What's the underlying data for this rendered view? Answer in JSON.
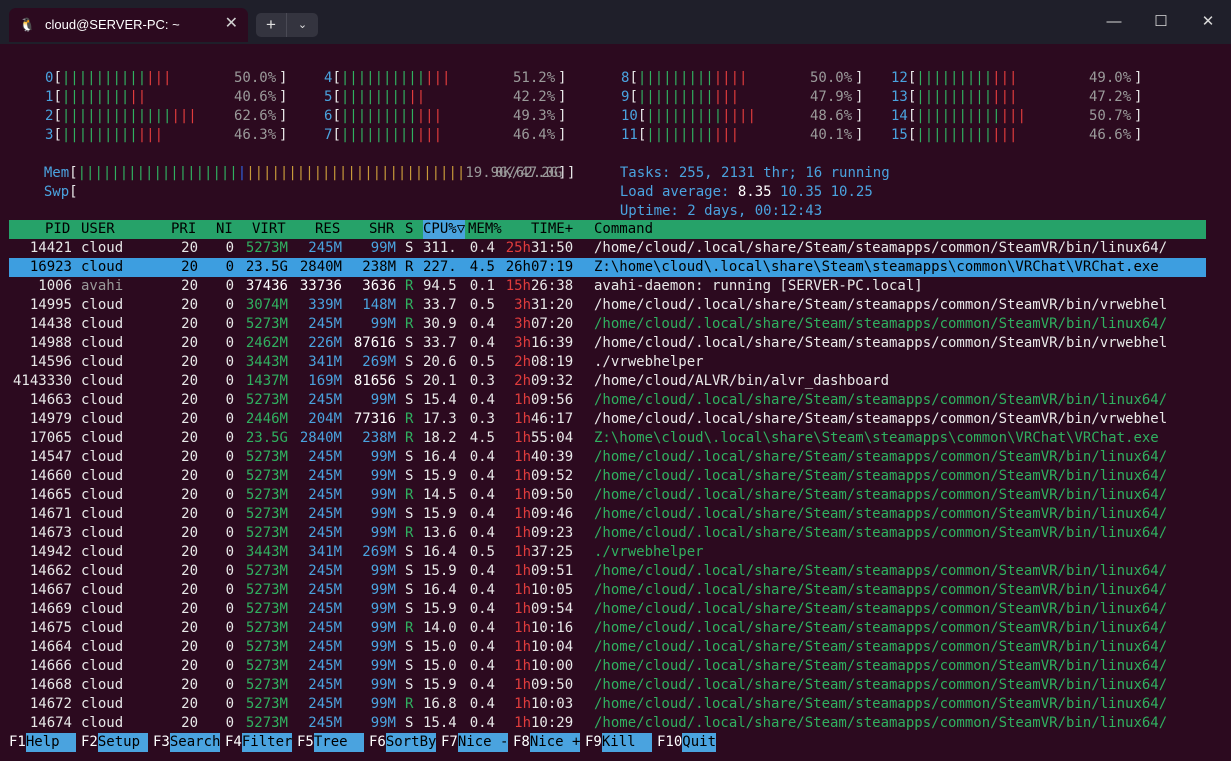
{
  "window": {
    "tab_title": "cloud@SERVER-PC: ~",
    "tab_icon": "linux-penguin-icon",
    "close_tab": "✕",
    "new_tab": "+",
    "dropdown": "⌄",
    "minimize": "—",
    "maximize": "☐",
    "close": "✕"
  },
  "cpus": [
    {
      "id": "0",
      "pct": "50.0%",
      "g": 10,
      "r": 3
    },
    {
      "id": "1",
      "pct": "40.6%",
      "g": 8,
      "r": 2
    },
    {
      "id": "2",
      "pct": "62.6%",
      "g": 13,
      "r": 3
    },
    {
      "id": "3",
      "pct": "46.3%",
      "g": 9,
      "r": 3
    },
    {
      "id": "4",
      "pct": "51.2%",
      "g": 10,
      "r": 3
    },
    {
      "id": "5",
      "pct": "42.2%",
      "g": 8,
      "r": 2
    },
    {
      "id": "6",
      "pct": "49.3%",
      "g": 9,
      "r": 3
    },
    {
      "id": "7",
      "pct": "46.4%",
      "g": 9,
      "r": 3
    },
    {
      "id": "8",
      "pct": "50.0%",
      "g": 9,
      "r": 4
    },
    {
      "id": "9",
      "pct": "47.9%",
      "g": 9,
      "r": 3
    },
    {
      "id": "10",
      "pct": "48.6%",
      "g": 9,
      "r": 4
    },
    {
      "id": "11",
      "pct": "40.1%",
      "g": 8,
      "r": 3
    },
    {
      "id": "12",
      "pct": "49.0%",
      "g": 9,
      "r": 3
    },
    {
      "id": "13",
      "pct": "47.2%",
      "g": 9,
      "r": 3
    },
    {
      "id": "14",
      "pct": "50.7%",
      "g": 10,
      "r": 3
    },
    {
      "id": "15",
      "pct": "46.6%",
      "g": 9,
      "r": 3
    }
  ],
  "mem": {
    "label": "Mem",
    "value": "19.9G/62.2G"
  },
  "swp": {
    "label": "Swp",
    "value": "0K/47.0G"
  },
  "tasks": {
    "label": "Tasks: ",
    "tasks": "255",
    "sep1": ", ",
    "thr": "2131",
    "thr_label": " thr; ",
    "running": "16",
    "running_label": " running"
  },
  "load": {
    "label": "Load average: ",
    "v1": "8.35",
    "v2": "10.35",
    "v3": "10.25"
  },
  "uptime": {
    "label": "Uptime: ",
    "value": "2 days, 00:12:43"
  },
  "columns": {
    "pid": "PID",
    "user": "USER",
    "pri": "PRI",
    "ni": "NI",
    "virt": "VIRT",
    "res": "RES",
    "shr": "SHR",
    "s": "S",
    "cpu": "CPU%▽",
    "mem": "MEM%",
    "time": "TIME+",
    "cmd": "Command"
  },
  "processes": [
    {
      "pid": "14421",
      "user": "cloud",
      "pri": "20",
      "ni": "0",
      "virt": "5273M",
      "res": "245M",
      "shr": "99M",
      "s": "S",
      "cpu": "311.",
      "mem": "0.4",
      "th": "25h",
      "tm": "31:50",
      "cmd": "/home/cloud/.local/share/Steam/steamapps/common/SteamVR/bin/linux64/",
      "thread": false
    },
    {
      "pid": "16923",
      "user": "cloud",
      "pri": "20",
      "ni": "0",
      "virt": "23.5G",
      "res": "2840M",
      "shr": "238M",
      "s": "R",
      "cpu": "227.",
      "mem": "4.5",
      "th": "26h",
      "tm": "07:19",
      "cmd": "Z:\\home\\cloud\\.local\\share\\Steam\\steamapps\\common\\VRChat\\VRChat.exe",
      "thread": false,
      "selected": true
    },
    {
      "pid": "1006",
      "user": "avahi",
      "pri": "20",
      "ni": "0",
      "virt": "37436",
      "res": "33736",
      "shr": "3636",
      "s": "R",
      "cpu": "94.5",
      "mem": "0.1",
      "th": "15h",
      "tm": "26:38",
      "cmd": "avahi-daemon: running [SERVER-PC.local]",
      "thread": false
    },
    {
      "pid": "14995",
      "user": "cloud",
      "pri": "20",
      "ni": "0",
      "virt": "3074M",
      "res": "339M",
      "shr": "148M",
      "s": "R",
      "cpu": "33.7",
      "mem": "0.5",
      "th": "3h",
      "tm": "31:20",
      "cmd": "/home/cloud/.local/share/Steam/steamapps/common/SteamVR/bin/vrwebhel",
      "thread": false
    },
    {
      "pid": "14438",
      "user": "cloud",
      "pri": "20",
      "ni": "0",
      "virt": "5273M",
      "res": "245M",
      "shr": "99M",
      "s": "R",
      "cpu": "30.9",
      "mem": "0.4",
      "th": "3h",
      "tm": "07:20",
      "cmd": "/home/cloud/.local/share/Steam/steamapps/common/SteamVR/bin/linux64/",
      "thread": true
    },
    {
      "pid": "14988",
      "user": "cloud",
      "pri": "20",
      "ni": "0",
      "virt": "2462M",
      "res": "226M",
      "shr": "87616",
      "s": "S",
      "cpu": "33.7",
      "mem": "0.4",
      "th": "3h",
      "tm": "16:39",
      "cmd": "/home/cloud/.local/share/Steam/steamapps/common/SteamVR/bin/vrwebhel",
      "thread": false
    },
    {
      "pid": "14596",
      "user": "cloud",
      "pri": "20",
      "ni": "0",
      "virt": "3443M",
      "res": "341M",
      "shr": "269M",
      "s": "S",
      "cpu": "20.6",
      "mem": "0.5",
      "th": "2h",
      "tm": "08:19",
      "cmd": "./vrwebhelper",
      "thread": false
    },
    {
      "pid": "4143330",
      "user": "cloud",
      "pri": "20",
      "ni": "0",
      "virt": "1437M",
      "res": "169M",
      "shr": "81656",
      "s": "S",
      "cpu": "20.1",
      "mem": "0.3",
      "th": "2h",
      "tm": "09:32",
      "cmd": "/home/cloud/ALVR/bin/alvr_dashboard",
      "thread": false
    },
    {
      "pid": "14663",
      "user": "cloud",
      "pri": "20",
      "ni": "0",
      "virt": "5273M",
      "res": "245M",
      "shr": "99M",
      "s": "S",
      "cpu": "15.4",
      "mem": "0.4",
      "th": "1h",
      "tm": "09:56",
      "cmd": "/home/cloud/.local/share/Steam/steamapps/common/SteamVR/bin/linux64/",
      "thread": true
    },
    {
      "pid": "14979",
      "user": "cloud",
      "pri": "20",
      "ni": "0",
      "virt": "2446M",
      "res": "204M",
      "shr": "77316",
      "s": "R",
      "cpu": "17.3",
      "mem": "0.3",
      "th": "1h",
      "tm": "46:17",
      "cmd": "/home/cloud/.local/share/Steam/steamapps/common/SteamVR/bin/vrwebhel",
      "thread": false
    },
    {
      "pid": "17065",
      "user": "cloud",
      "pri": "20",
      "ni": "0",
      "virt": "23.5G",
      "res": "2840M",
      "shr": "238M",
      "s": "R",
      "cpu": "18.2",
      "mem": "4.5",
      "th": "1h",
      "tm": "55:04",
      "cmd": "Z:\\home\\cloud\\.local\\share\\Steam\\steamapps\\common\\VRChat\\VRChat.exe",
      "thread": true
    },
    {
      "pid": "14547",
      "user": "cloud",
      "pri": "20",
      "ni": "0",
      "virt": "5273M",
      "res": "245M",
      "shr": "99M",
      "s": "S",
      "cpu": "16.4",
      "mem": "0.4",
      "th": "1h",
      "tm": "40:39",
      "cmd": "/home/cloud/.local/share/Steam/steamapps/common/SteamVR/bin/linux64/",
      "thread": true
    },
    {
      "pid": "14660",
      "user": "cloud",
      "pri": "20",
      "ni": "0",
      "virt": "5273M",
      "res": "245M",
      "shr": "99M",
      "s": "S",
      "cpu": "15.9",
      "mem": "0.4",
      "th": "1h",
      "tm": "09:52",
      "cmd": "/home/cloud/.local/share/Steam/steamapps/common/SteamVR/bin/linux64/",
      "thread": true
    },
    {
      "pid": "14665",
      "user": "cloud",
      "pri": "20",
      "ni": "0",
      "virt": "5273M",
      "res": "245M",
      "shr": "99M",
      "s": "R",
      "cpu": "14.5",
      "mem": "0.4",
      "th": "1h",
      "tm": "09:50",
      "cmd": "/home/cloud/.local/share/Steam/steamapps/common/SteamVR/bin/linux64/",
      "thread": true
    },
    {
      "pid": "14671",
      "user": "cloud",
      "pri": "20",
      "ni": "0",
      "virt": "5273M",
      "res": "245M",
      "shr": "99M",
      "s": "S",
      "cpu": "15.9",
      "mem": "0.4",
      "th": "1h",
      "tm": "09:46",
      "cmd": "/home/cloud/.local/share/Steam/steamapps/common/SteamVR/bin/linux64/",
      "thread": true
    },
    {
      "pid": "14673",
      "user": "cloud",
      "pri": "20",
      "ni": "0",
      "virt": "5273M",
      "res": "245M",
      "shr": "99M",
      "s": "R",
      "cpu": "13.6",
      "mem": "0.4",
      "th": "1h",
      "tm": "09:23",
      "cmd": "/home/cloud/.local/share/Steam/steamapps/common/SteamVR/bin/linux64/",
      "thread": true
    },
    {
      "pid": "14942",
      "user": "cloud",
      "pri": "20",
      "ni": "0",
      "virt": "3443M",
      "res": "341M",
      "shr": "269M",
      "s": "S",
      "cpu": "16.4",
      "mem": "0.5",
      "th": "1h",
      "tm": "37:25",
      "cmd": "./vrwebhelper",
      "thread": true
    },
    {
      "pid": "14662",
      "user": "cloud",
      "pri": "20",
      "ni": "0",
      "virt": "5273M",
      "res": "245M",
      "shr": "99M",
      "s": "S",
      "cpu": "15.9",
      "mem": "0.4",
      "th": "1h",
      "tm": "09:51",
      "cmd": "/home/cloud/.local/share/Steam/steamapps/common/SteamVR/bin/linux64/",
      "thread": true
    },
    {
      "pid": "14667",
      "user": "cloud",
      "pri": "20",
      "ni": "0",
      "virt": "5273M",
      "res": "245M",
      "shr": "99M",
      "s": "S",
      "cpu": "16.4",
      "mem": "0.4",
      "th": "1h",
      "tm": "10:05",
      "cmd": "/home/cloud/.local/share/Steam/steamapps/common/SteamVR/bin/linux64/",
      "thread": true
    },
    {
      "pid": "14669",
      "user": "cloud",
      "pri": "20",
      "ni": "0",
      "virt": "5273M",
      "res": "245M",
      "shr": "99M",
      "s": "S",
      "cpu": "15.9",
      "mem": "0.4",
      "th": "1h",
      "tm": "09:54",
      "cmd": "/home/cloud/.local/share/Steam/steamapps/common/SteamVR/bin/linux64/",
      "thread": true
    },
    {
      "pid": "14675",
      "user": "cloud",
      "pri": "20",
      "ni": "0",
      "virt": "5273M",
      "res": "245M",
      "shr": "99M",
      "s": "R",
      "cpu": "14.0",
      "mem": "0.4",
      "th": "1h",
      "tm": "10:16",
      "cmd": "/home/cloud/.local/share/Steam/steamapps/common/SteamVR/bin/linux64/",
      "thread": true
    },
    {
      "pid": "14664",
      "user": "cloud",
      "pri": "20",
      "ni": "0",
      "virt": "5273M",
      "res": "245M",
      "shr": "99M",
      "s": "S",
      "cpu": "15.0",
      "mem": "0.4",
      "th": "1h",
      "tm": "10:04",
      "cmd": "/home/cloud/.local/share/Steam/steamapps/common/SteamVR/bin/linux64/",
      "thread": true
    },
    {
      "pid": "14666",
      "user": "cloud",
      "pri": "20",
      "ni": "0",
      "virt": "5273M",
      "res": "245M",
      "shr": "99M",
      "s": "S",
      "cpu": "15.0",
      "mem": "0.4",
      "th": "1h",
      "tm": "10:00",
      "cmd": "/home/cloud/.local/share/Steam/steamapps/common/SteamVR/bin/linux64/",
      "thread": true
    },
    {
      "pid": "14668",
      "user": "cloud",
      "pri": "20",
      "ni": "0",
      "virt": "5273M",
      "res": "245M",
      "shr": "99M",
      "s": "S",
      "cpu": "15.9",
      "mem": "0.4",
      "th": "1h",
      "tm": "09:50",
      "cmd": "/home/cloud/.local/share/Steam/steamapps/common/SteamVR/bin/linux64/",
      "thread": true
    },
    {
      "pid": "14672",
      "user": "cloud",
      "pri": "20",
      "ni": "0",
      "virt": "5273M",
      "res": "245M",
      "shr": "99M",
      "s": "R",
      "cpu": "16.8",
      "mem": "0.4",
      "th": "1h",
      "tm": "10:03",
      "cmd": "/home/cloud/.local/share/Steam/steamapps/common/SteamVR/bin/linux64/",
      "thread": true
    },
    {
      "pid": "14674",
      "user": "cloud",
      "pri": "20",
      "ni": "0",
      "virt": "5273M",
      "res": "245M",
      "shr": "99M",
      "s": "S",
      "cpu": "15.4",
      "mem": "0.4",
      "th": "1h",
      "tm": "10:29",
      "cmd": "/home/cloud/.local/share/Steam/steamapps/common/SteamVR/bin/linux64/",
      "thread": true
    }
  ],
  "fkeys": [
    {
      "key": "F1",
      "label": "Help  "
    },
    {
      "key": "F2",
      "label": "Setup "
    },
    {
      "key": "F3",
      "label": "Search"
    },
    {
      "key": "F4",
      "label": "Filter"
    },
    {
      "key": "F5",
      "label": "Tree  "
    },
    {
      "key": "F6",
      "label": "SortBy"
    },
    {
      "key": "F7",
      "label": "Nice -"
    },
    {
      "key": "F8",
      "label": "Nice +"
    },
    {
      "key": "F9",
      "label": "Kill  "
    },
    {
      "key": "F10",
      "label": "Quit"
    }
  ],
  "colors": {
    "bg": "#2c0a1f",
    "header": "#26a269",
    "selected": "#3d9ee0",
    "accent": "#4aa3df"
  }
}
